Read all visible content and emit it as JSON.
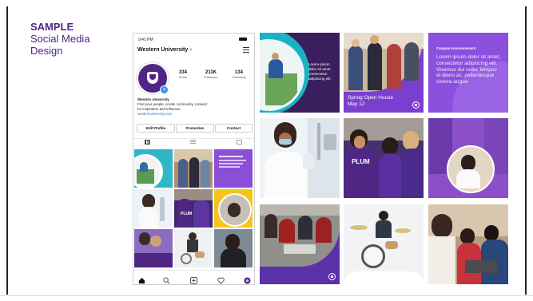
{
  "heading": {
    "title": "SAMPLE",
    "subtitle_line1": "Social Media",
    "subtitle_line2": "Design"
  },
  "phone": {
    "status_time": "9:41 PM",
    "username": "Western University",
    "username_caret": "˅",
    "stats": [
      {
        "value": "334",
        "label": "Posts"
      },
      {
        "value": "211K",
        "label": "Followers"
      },
      {
        "value": "134",
        "label": "Following"
      }
    ],
    "bio_name": "Western University",
    "bio_line1": "Find your people, create community, connect",
    "bio_line2": "for inspiration and influence.",
    "bio_link": "westernuniversity.com",
    "buttons": {
      "edit": "Edit Profile",
      "promotion": "Promotion",
      "contact": "Contact"
    },
    "tabs": [
      "grid-icon",
      "list-icon",
      "tagged-icon"
    ],
    "nav": [
      "home-icon",
      "search-icon",
      "add-icon",
      "heart-icon",
      "profile-icon"
    ]
  },
  "tiles": {
    "t1_text": "Lorem ipsum dolor sit amet, consectetur adipiscing elit.",
    "t2_title": "Spring Open House",
    "t2_date": "May 12",
    "t3_title": "Campus Announcement",
    "t3_text": "Lorem ipsum dolor sit amet, consectetur adipiscing elit. Vivamus dui nulla, tempus et libero ac, pellentesque viverra augue.",
    "jersey_text": "PLUM"
  },
  "colors": {
    "purple": "#4f2683",
    "violet": "#7e44d8",
    "teal": "#1ab3c4",
    "yellow": "#f5c51c"
  }
}
